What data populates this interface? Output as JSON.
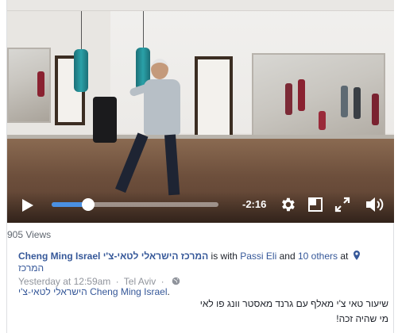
{
  "video": {
    "progress_fraction": 0.22,
    "time_remaining": "-2:16",
    "icons": {
      "play": "play-icon",
      "settings": "gear-icon",
      "pip": "picture-in-picture-icon",
      "fullscreen": "fullscreen-icon",
      "volume": "volume-icon"
    }
  },
  "stats": {
    "views": "905 Views"
  },
  "attribution": {
    "page_name": "Cheng Ming Israel המרכז הישראלי לטאי-צ'י",
    "is_with": "is with",
    "tagged_person": "Passi Eli",
    "and": "and",
    "others": "10 others",
    "at": "at",
    "location_part1": "המרכז",
    "location_part2": "הישראלי לטאי-צ'י Cheng Ming Israel",
    "period": "."
  },
  "meta": {
    "timestamp": "Yesterday at 12:59am",
    "separator": "·",
    "place": "Tel Aviv",
    "separator2": "·"
  },
  "post": {
    "line1": "שיעור טאי צ'י מאלף עם גרנד מאסטר וונג פו לאי",
    "line2": "מי שהיה זכה!"
  },
  "colors": {
    "link": "#365899",
    "seek_fill": "#4a90e2",
    "muted": "#90949c"
  }
}
